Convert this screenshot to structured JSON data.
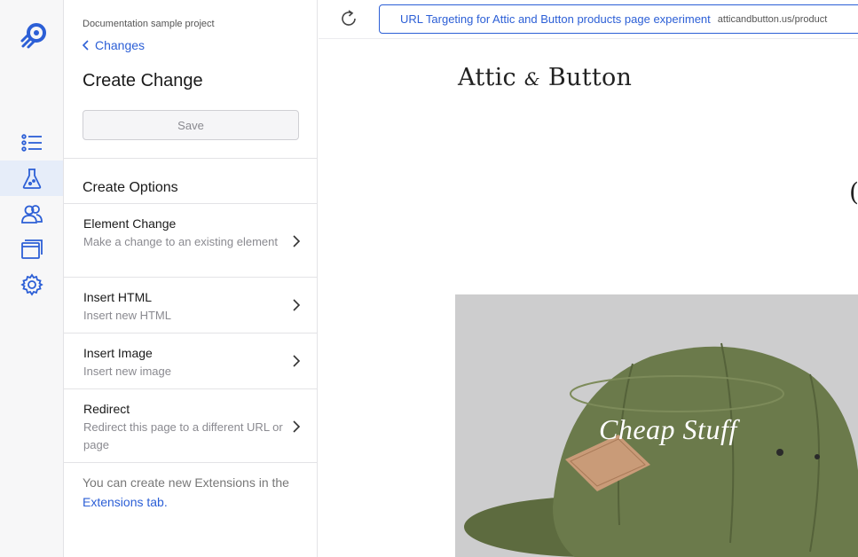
{
  "colors": {
    "accent": "#2c5fd6",
    "rail_bg": "#f7f7f8",
    "active_bg": "#e6edf9",
    "hat_green": "#6b7a4b"
  },
  "rail": {
    "logo_icon": "rocket-logo-icon",
    "items": [
      {
        "icon": "list-icon",
        "active": false
      },
      {
        "icon": "flask-icon",
        "active": true
      },
      {
        "icon": "users-icon",
        "active": false
      },
      {
        "icon": "windows-icon",
        "active": false
      },
      {
        "icon": "gear-icon",
        "active": false
      }
    ]
  },
  "panel": {
    "project": "Documentation sample project",
    "back_label": "Changes",
    "title": "Create Change",
    "save_label": "Save",
    "options_title": "Create Options",
    "options": [
      {
        "title": "Element Change",
        "desc": "Make a change to an existing element"
      },
      {
        "title": "Insert HTML",
        "desc": "Insert new HTML"
      },
      {
        "title": "Insert Image",
        "desc": "Insert new image"
      },
      {
        "title": "Redirect",
        "desc": "Redirect this page to a different URL or page"
      }
    ],
    "hint_text": "You can create new Extensions in the ",
    "hint_link": "Extensions tab."
  },
  "preview": {
    "experiment": "URL Targeting for Attic and Button products page experiment",
    "url": "atticandbutton.us/product",
    "brand_left": "Attic",
    "brand_amp": "&",
    "brand_right": "Button",
    "edge_glyph": "(",
    "hero_caption": "Cheap Stuff"
  }
}
